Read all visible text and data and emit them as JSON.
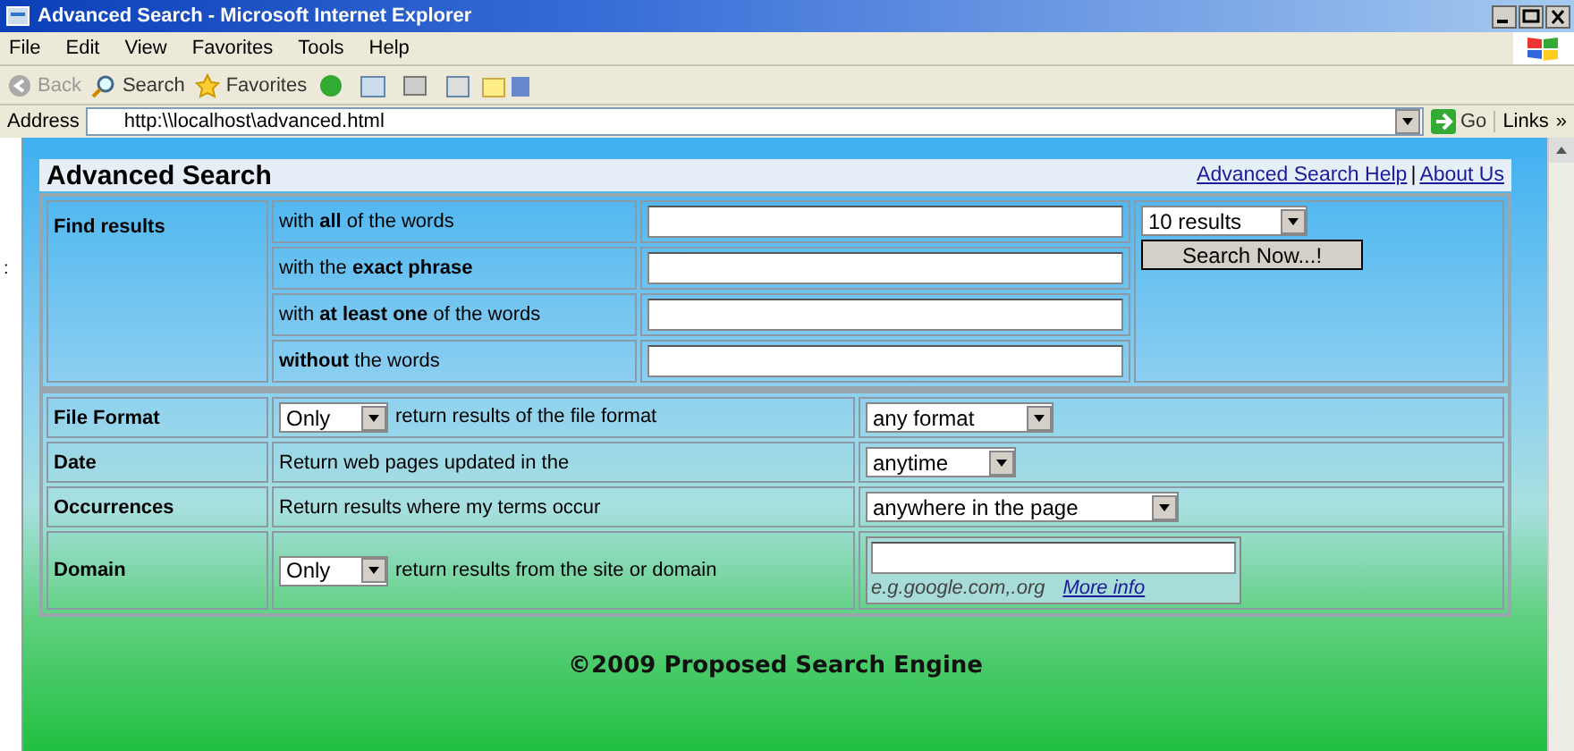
{
  "window": {
    "title": "Advanced Search - Microsoft Internet Explorer"
  },
  "menu": [
    "File",
    "Edit",
    "View",
    "Favorites",
    "Tools",
    "Help"
  ],
  "toolbar": [
    {
      "kind": "back",
      "label": "Back"
    },
    {
      "kind": "search",
      "label": "Search"
    },
    {
      "kind": "favorites",
      "label": "Favorites"
    }
  ],
  "address": {
    "label": "Address",
    "value": "http:\\\\localhost\\advanced.html",
    "go": "Go",
    "links": "Links",
    "more": "»"
  },
  "stray_mark": ":",
  "page": {
    "heading": "Advanced Search",
    "links": [
      "Advanced Search Help",
      "About Us"
    ],
    "separator": "|",
    "find_results": {
      "label": "Find results",
      "rows": [
        {
          "label": "with **all** of the words"
        },
        {
          "label": "with the **exact phrase**"
        },
        {
          "label": "with **at least one** of the words"
        },
        {
          "label": "**without** the words"
        }
      ],
      "count_select": "10 results",
      "button": "Search Now...!"
    },
    "options": [
      {
        "kind": "select",
        "label": "File Format",
        "prefix_select": "Only",
        "text": "return results of the file format",
        "select": "any format"
      },
      {
        "kind": "select",
        "label": "Date",
        "text": "Return web pages updated in the",
        "select": "anytime"
      },
      {
        "kind": "select",
        "label": "Occurrences",
        "text": "Return results where my terms occur",
        "select": "anywhere in the page"
      },
      {
        "kind": "domain",
        "label": "Domain",
        "prefix_select": "Only",
        "text": "return results from the site or domain",
        "hint": "e.g.google.com,.org",
        "link": "More info"
      }
    ],
    "footer": "©2009 Proposed Search Engine"
  }
}
